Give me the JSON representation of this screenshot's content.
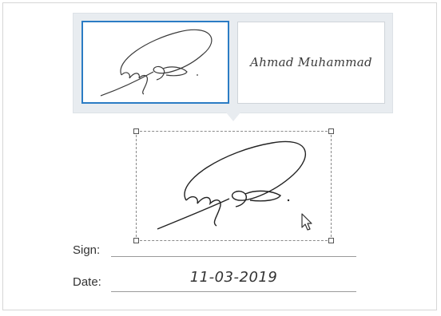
{
  "signature_options": [
    {
      "kind": "drawn",
      "selected": true
    },
    {
      "kind": "typed",
      "text": "Ahmad Muhammad",
      "selected": false
    }
  ],
  "fields": {
    "sign_label": "Sign:",
    "date_label": "Date:",
    "date_value": "11-03-2019"
  },
  "colors": {
    "selection_border": "#2b7cc4",
    "picker_background": "#e8ecf0"
  },
  "icons": {
    "cursor": "mouse-pointer-icon"
  }
}
